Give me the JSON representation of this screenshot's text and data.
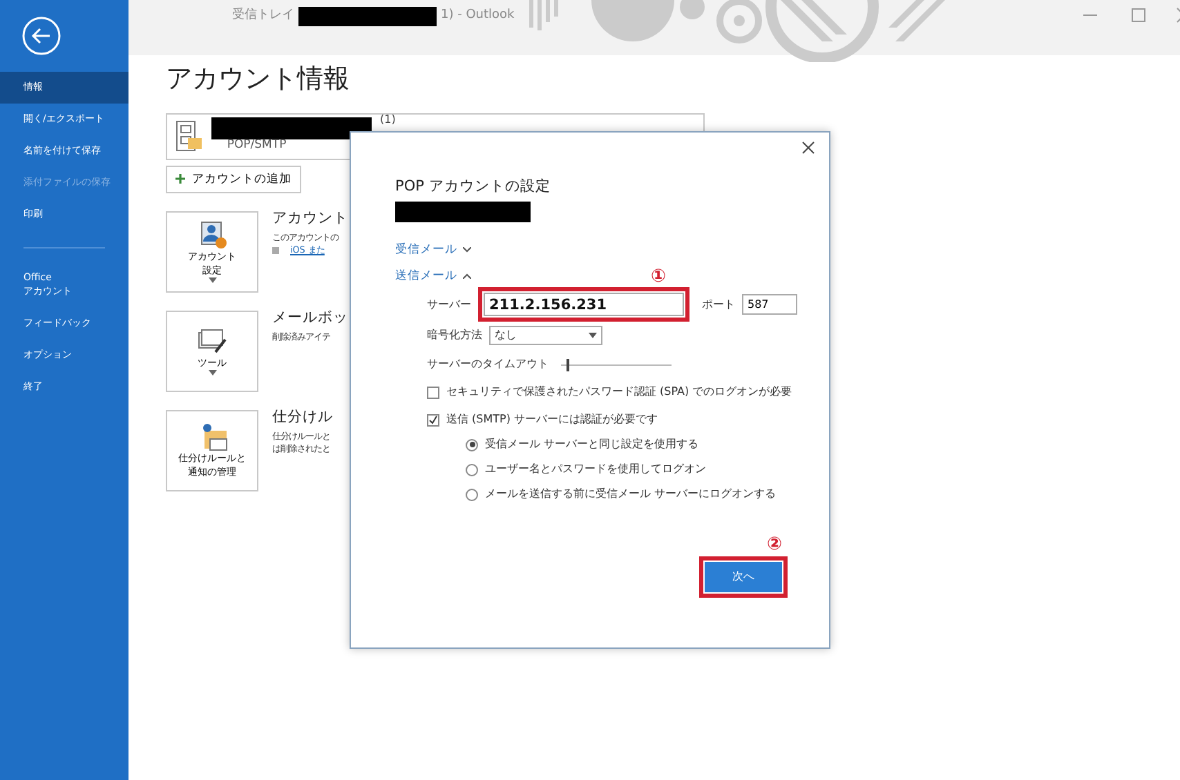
{
  "window": {
    "title_left": "受信トレイ",
    "title_right": "1)  -  Outlook"
  },
  "sidebar": {
    "items": [
      {
        "label": "情報",
        "selected": true,
        "disabled": false
      },
      {
        "label": "開く/エクスポート",
        "selected": false,
        "disabled": false
      },
      {
        "label": "名前を付けて保存",
        "selected": false,
        "disabled": false
      },
      {
        "label": "添付ファイルの保存",
        "selected": false,
        "disabled": true
      },
      {
        "label": "印刷",
        "selected": false,
        "disabled": false
      },
      {
        "label": "Office\nアカウント",
        "selected": false,
        "disabled": false,
        "kind": "group-start"
      },
      {
        "label": "フィードバック",
        "selected": false,
        "disabled": false
      },
      {
        "label": "オプション",
        "selected": false,
        "disabled": false
      },
      {
        "label": "終了",
        "selected": false,
        "disabled": false
      }
    ]
  },
  "main": {
    "heading": "アカウント情報",
    "account": {
      "type": "POP/SMTP",
      "suffix": "(1)"
    },
    "add_button": "アカウントの追加",
    "sections": [
      {
        "kind": "account",
        "button": "アカウント設定",
        "dropdown": true,
        "title": "アカウント",
        "lines": [
          {
            "text": "このアカウントの",
            "kind": "text"
          },
          {
            "text": "iOS また",
            "kind": "link"
          }
        ]
      },
      {
        "kind": "tools",
        "button": "ツール",
        "dropdown": true,
        "title": "メールボッ",
        "lines": [
          {
            "text": "削除済みアイテ",
            "kind": "text"
          }
        ]
      },
      {
        "kind": "rules",
        "button": "仕分けルールと通知の管理",
        "dropdown": false,
        "title": "仕分けル",
        "lines": [
          {
            "text": "仕分けルールと",
            "kind": "text"
          },
          {
            "text": "は削除されたと",
            "kind": "text"
          }
        ]
      }
    ]
  },
  "dialog": {
    "title": "POP アカウントの設定",
    "incoming": {
      "label": "受信メール",
      "expanded": false
    },
    "outgoing": {
      "label": "送信メール",
      "expanded": true
    },
    "server": {
      "label": "サーバー",
      "value": "211.2.156.231"
    },
    "port": {
      "label": "ポート",
      "value": "587"
    },
    "encryption": {
      "label": "暗号化方法",
      "value": "なし"
    },
    "timeout": {
      "label": "サーバーのタイムアウト",
      "level": 0.05
    },
    "checkboxes": [
      {
        "label": "セキュリティで保護されたパスワード認証 (SPA) でのログオンが必要",
        "checked": false
      },
      {
        "label": "送信 (SMTP) サーバーには認証が必要です",
        "checked": true
      }
    ],
    "radios": [
      {
        "label": "受信メール サーバーと同じ設定を使用する",
        "selected": true
      },
      {
        "label": "ユーザー名とパスワードを使用してログオン",
        "selected": false
      },
      {
        "label": "メールを送信する前に受信メール サーバーにログオンする",
        "selected": false
      }
    ],
    "next_button": "次へ",
    "annotations": [
      "①",
      "②"
    ]
  }
}
